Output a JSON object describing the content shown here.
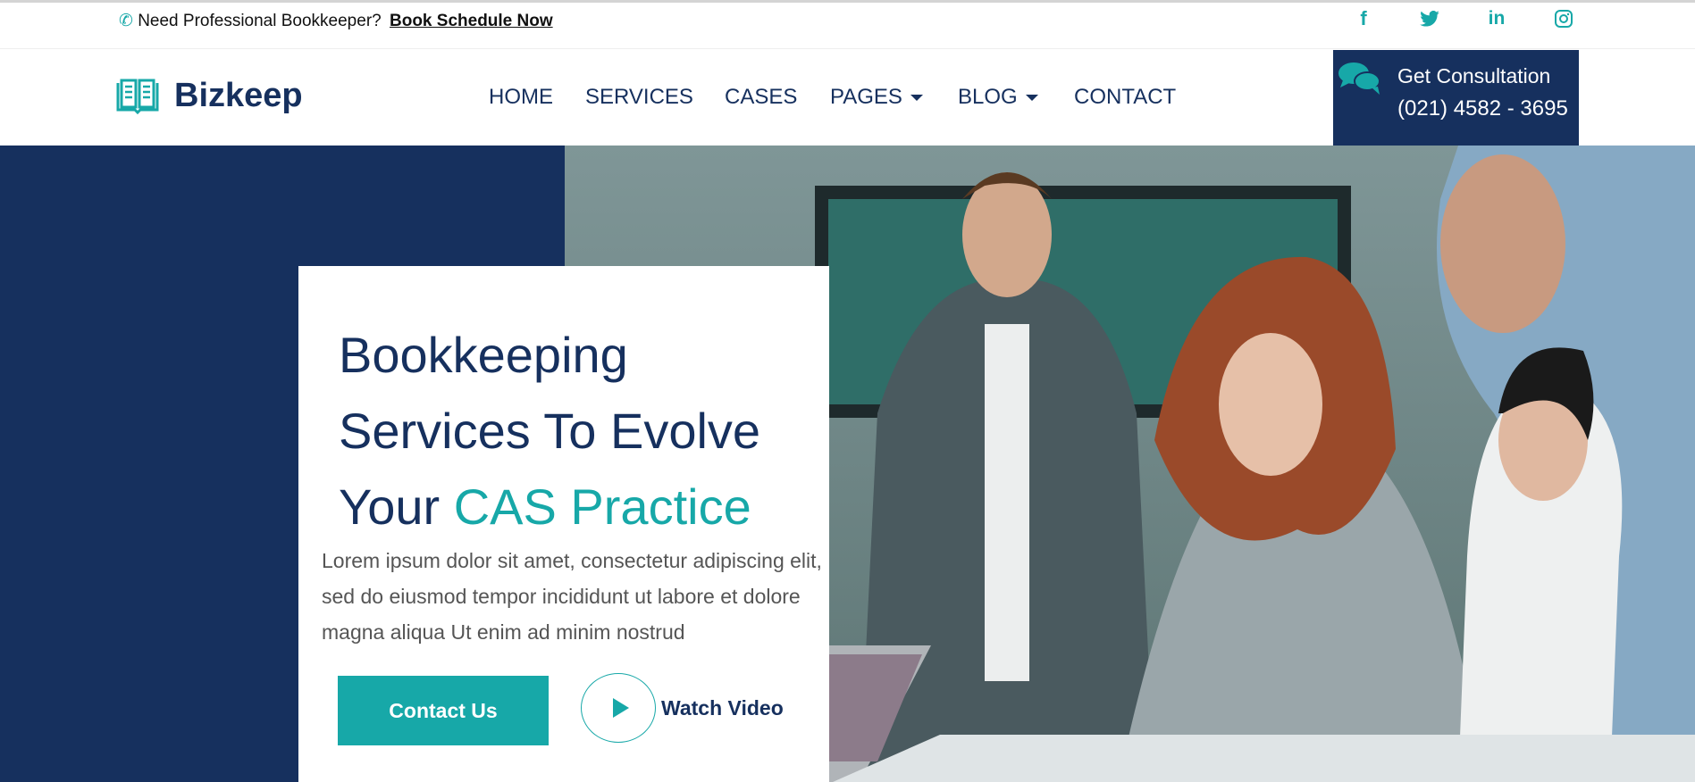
{
  "topbar": {
    "prompt": "Need Professional Bookkeeper?",
    "link": "Book Schedule Now",
    "social": [
      "facebook-icon",
      "twitter-icon",
      "linkedin-icon",
      "instagram-icon"
    ]
  },
  "header": {
    "brand": "Bizkeep",
    "nav": [
      {
        "label": "HOME"
      },
      {
        "label": "SERVICES"
      },
      {
        "label": "CASES"
      },
      {
        "label": "PAGES",
        "dropdown": true
      },
      {
        "label": "BLOG",
        "dropdown": true
      },
      {
        "label": "CONTACT"
      }
    ],
    "consult": {
      "title": "Get Consultation",
      "phone": "(021) 4582 - 3695"
    }
  },
  "hero": {
    "title_line1": "Bookkeeping",
    "title_line2": "Services To Evolve",
    "title_line3_prefix": "Your ",
    "title_highlight": "CAS Practice",
    "paragraph": "Lorem ipsum dolor sit amet, consectetur adipiscing elit, sed do eiusmod tempor incididunt ut labore et dolore magna aliqua Ut enim ad minim nostrud",
    "contact_button": "Contact Us",
    "watch_video": "Watch Video"
  },
  "colors": {
    "navy": "#16305e",
    "teal": "#17a8a8"
  }
}
